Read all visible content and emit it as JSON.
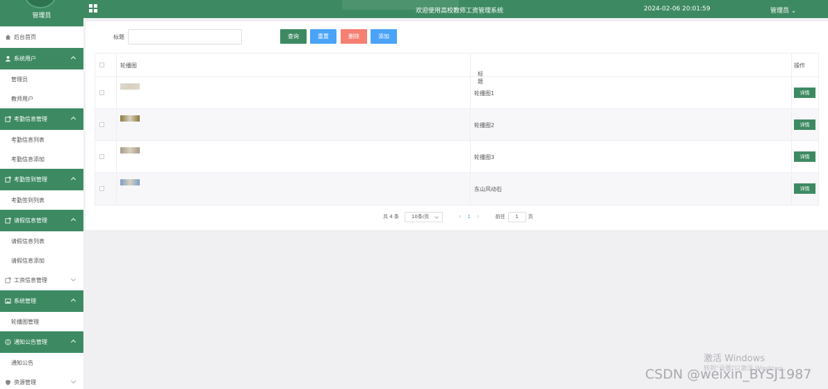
{
  "sidebar": {
    "role": "管理员",
    "items": [
      {
        "label": "后台首页",
        "type": "top",
        "icon": "home-icon"
      },
      {
        "label": "系统用户",
        "type": "group",
        "icon": "user-icon",
        "expanded": true
      },
      {
        "label": "管理员",
        "type": "sub"
      },
      {
        "label": "教师用户",
        "type": "sub"
      },
      {
        "label": "考勤信息管理",
        "type": "group",
        "icon": "folder-icon",
        "expanded": true
      },
      {
        "label": "考勤信息列表",
        "type": "sub"
      },
      {
        "label": "考勤信息添加",
        "type": "sub"
      },
      {
        "label": "考勤签到管理",
        "type": "group",
        "icon": "folder-icon",
        "expanded": true
      },
      {
        "label": "考勤签到列表",
        "type": "sub"
      },
      {
        "label": "请假信息管理",
        "type": "group",
        "icon": "folder-icon",
        "expanded": true
      },
      {
        "label": "请假信息列表",
        "type": "sub"
      },
      {
        "label": "请假信息添加",
        "type": "sub"
      },
      {
        "label": "工资信息管理",
        "type": "collapsed",
        "icon": "folder-icon",
        "expanded": false
      },
      {
        "label": "系统管理",
        "type": "group",
        "icon": "image-icon",
        "expanded": true
      },
      {
        "label": "轮播图管理",
        "type": "sub"
      },
      {
        "label": "通知公告管理",
        "type": "group",
        "icon": "info-icon",
        "expanded": true
      },
      {
        "label": "通知公告",
        "type": "sub"
      },
      {
        "label": "资源管理",
        "type": "collapsed",
        "icon": "shield-icon",
        "expanded": false
      }
    ]
  },
  "topbar": {
    "title": "欢迎使用高校教师工资管理系统",
    "datetime": "2024-02-06 20:01:59",
    "user": "管理员"
  },
  "search": {
    "label": "标题",
    "value": "",
    "buttons": {
      "query": "查询",
      "reset": "重置",
      "delete": "删除",
      "add": "添加"
    }
  },
  "table": {
    "headers": {
      "image": "轮播图",
      "title": "标题",
      "op": "操作"
    },
    "rows": [
      {
        "title": "轮播图1",
        "action": "详情",
        "thumb_color": "#ddd8cc"
      },
      {
        "title": "轮播图2",
        "action": "详情",
        "thumb_color": "#8a7a3a"
      },
      {
        "title": "轮播图3",
        "action": "详情",
        "thumb_color": "#a89a88"
      },
      {
        "title": "东山风动石",
        "action": "详情",
        "thumb_color": "#7aa0c8"
      }
    ]
  },
  "pager": {
    "total": "共 4 条",
    "page_size": "10条/页",
    "current": "1",
    "goto_label": "前往",
    "goto_value": "1",
    "page_suffix": "页"
  },
  "watermarks": {
    "activate": "激活 Windows",
    "activate_hint": "转到\"设置\"以激活 Windows。",
    "csdn": "CSDN @weixin_BYSJ1987"
  },
  "colors": {
    "brand": "#3d8a62",
    "blue": "#4aa3f7",
    "red": "#f47f72"
  }
}
